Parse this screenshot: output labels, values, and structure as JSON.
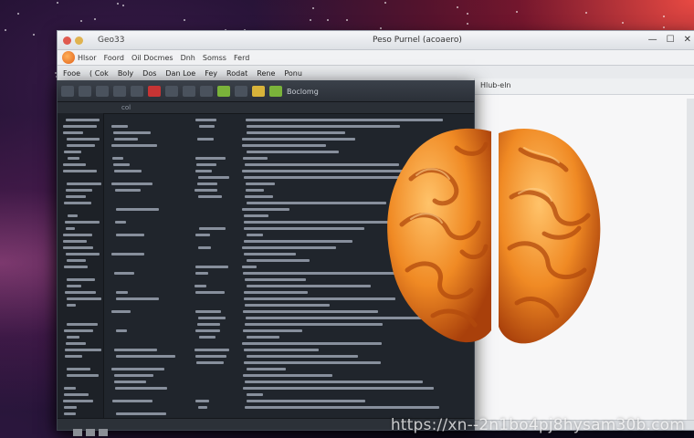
{
  "back_window": {
    "title": "Geo33",
    "center_title": "Peso Purnel (acoaero)",
    "controls": [
      "—",
      "☐",
      "✕"
    ],
    "menu": [
      "Hlsor",
      "Foord",
      "Oil Docmes",
      "Dnh",
      "Somss",
      "Ferd"
    ],
    "toolbar": [
      "Fooe",
      "( Cok",
      "Boly",
      "Dos",
      "Dan Loe",
      "Fey",
      "Rodat",
      "Rene",
      "Ponu"
    ],
    "right_header": "Hlub-eln"
  },
  "editor": {
    "toolbar_label": "Boclomg",
    "tab_marker": "col"
  },
  "brain": {
    "color_primary": "#f08a24",
    "color_shadow": "#a9400b",
    "color_highlight": "#ffc36a"
  },
  "watermark": "https://xn--2n1bo4pj8hysam30b.com"
}
